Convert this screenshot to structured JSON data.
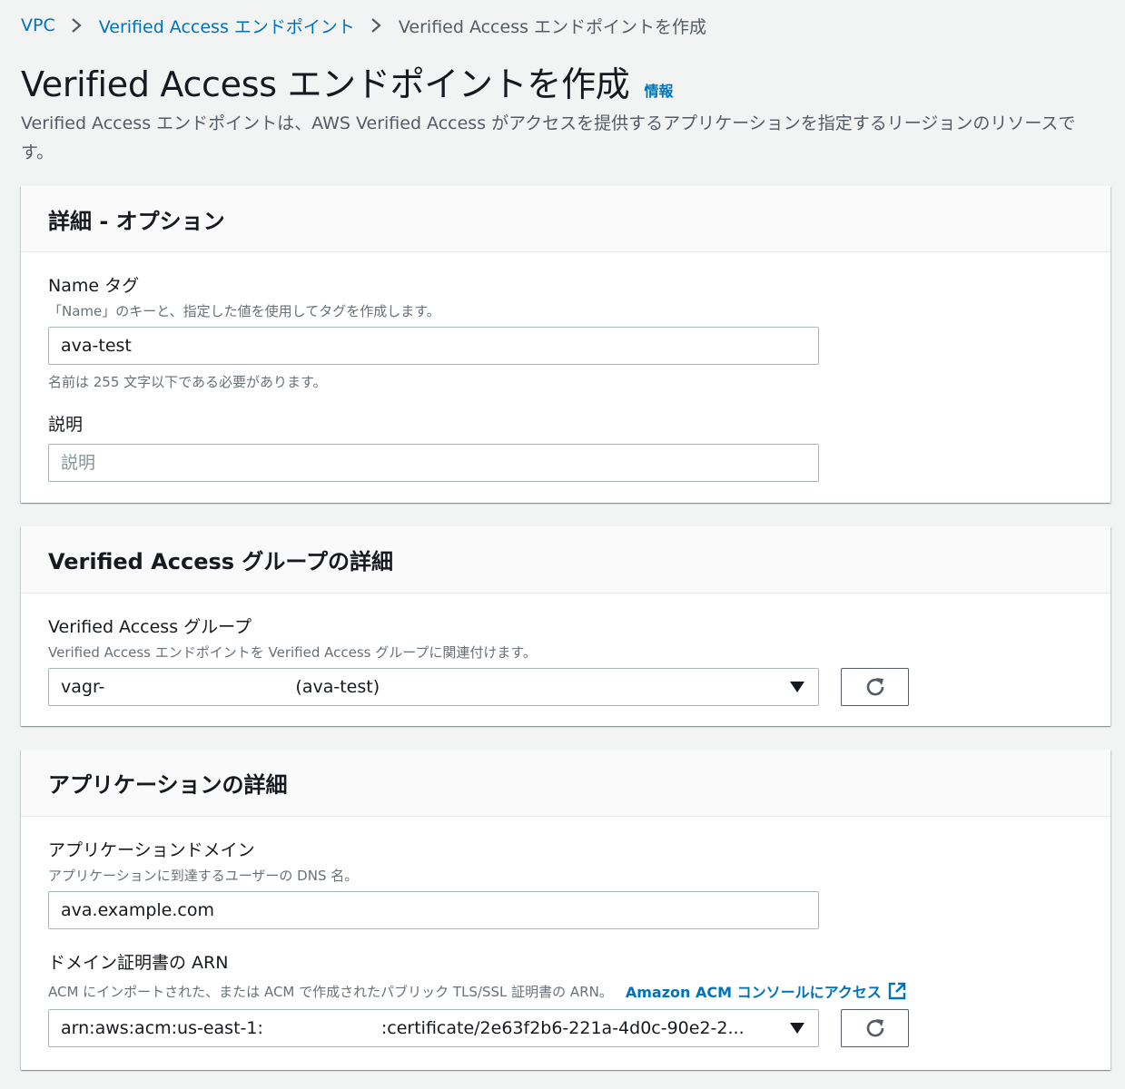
{
  "breadcrumb": {
    "items": [
      "VPC",
      "Verified Access エンドポイント"
    ],
    "current": "Verified Access エンドポイントを作成"
  },
  "page": {
    "title": "Verified Access エンドポイントを作成",
    "info": "情報",
    "description": "Verified Access エンドポイントは、AWS Verified Access がアクセスを提供するアプリケーションを指定するリージョンのリソースです。"
  },
  "details": {
    "header": "詳細 - オプション",
    "name_tag": {
      "label": "Name タグ",
      "description": "「Name」のキーと、指定した値を使用してタグを作成します。",
      "value": "ava-test",
      "constraint": "名前は 255 文字以下である必要があります。"
    },
    "description_field": {
      "label": "説明",
      "placeholder": "説明",
      "value": ""
    }
  },
  "group": {
    "header": "Verified Access グループの詳細",
    "label": "Verified Access グループ",
    "description": "Verified Access エンドポイントを Verified Access グループに関連付けます。",
    "selected_prefix": "vagr-",
    "selected_suffix": "(ava-test)"
  },
  "application": {
    "header": "アプリケーションの詳細",
    "domain": {
      "label": "アプリケーションドメイン",
      "description": "アプリケーションに到達するユーザーの DNS 名。",
      "value": "ava.example.com"
    },
    "certificate": {
      "label": "ドメイン証明書の ARN",
      "description": "ACM にインポートされた、または ACM で作成されたパブリック TLS/SSL 証明書の ARN。",
      "link": "Amazon ACM コンソールにアクセス",
      "selected_prefix": "arn:aws:acm:us-east-1:",
      "selected_suffix": ":certificate/2e63f2b6-221a-4d0c-90e2-2..."
    }
  },
  "icons": {
    "breadcrumb_separator": "chevron-right-icon",
    "dropdown": "caret-down-icon",
    "refresh": "refresh-icon",
    "external": "external-link-icon"
  },
  "colors": {
    "link": "#0073bb",
    "background": "#f2f3f3",
    "panel_header": "#fafafa",
    "text": "#16191f",
    "secondary_text": "#687078"
  }
}
